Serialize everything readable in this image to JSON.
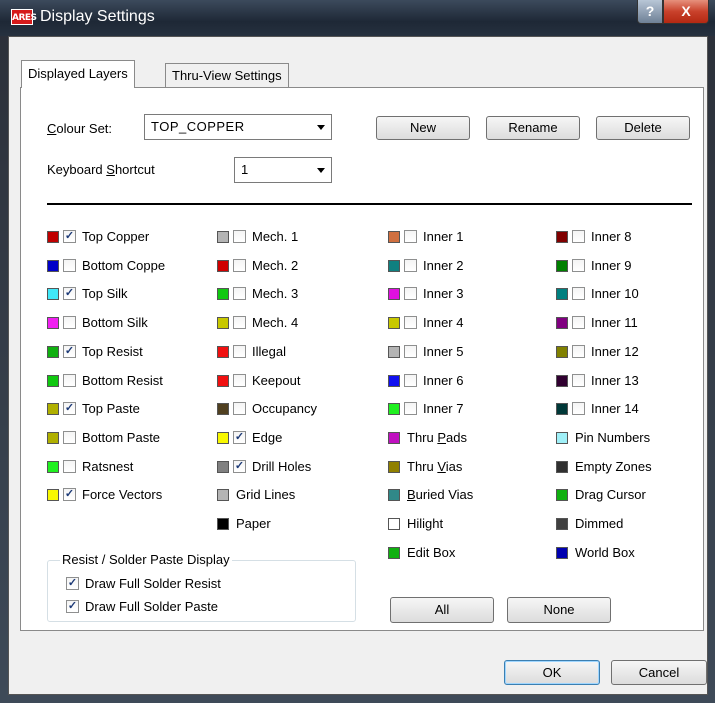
{
  "window": {
    "title": "Display Settings",
    "app_icon_text": "ARES",
    "help_symbol": "?",
    "close_symbol": "X"
  },
  "tabs": [
    {
      "label": "Displayed Layers"
    },
    {
      "label": "Thru-View Settings"
    }
  ],
  "colour_set": {
    "label": "Colour Set:",
    "value": "TOP_COPPER"
  },
  "keyboard_shortcut": {
    "label": "Keyboard Shortcut",
    "value": "1"
  },
  "buttons": {
    "new": "New",
    "rename": "Rename",
    "delete": "Delete",
    "all": "All",
    "none": "None",
    "ok": "OK",
    "cancel": "Cancel"
  },
  "layers": [
    [
      {
        "label": "Top Copper",
        "color": "#c00000",
        "checkbox": true,
        "checked": true
      },
      {
        "label": "Bottom Coppe",
        "color": "#0000c8",
        "checkbox": true,
        "checked": false
      },
      {
        "label": "Top Silk",
        "color": "#40e8f8",
        "checkbox": true,
        "checked": true
      },
      {
        "label": "Bottom Silk",
        "color": "#f020f0",
        "checkbox": true,
        "checked": false
      },
      {
        "label": "Top Resist",
        "color": "#10b010",
        "checkbox": true,
        "checked": true
      },
      {
        "label": "Bottom Resist",
        "color": "#10c810",
        "checkbox": true,
        "checked": false
      },
      {
        "label": "Top Paste",
        "color": "#b0b000",
        "checkbox": true,
        "checked": true
      },
      {
        "label": "Bottom Paste",
        "color": "#b0b000",
        "checkbox": true,
        "checked": false
      },
      {
        "label": "Ratsnest",
        "color": "#20f020",
        "checkbox": true,
        "checked": false
      },
      {
        "label": "Force Vectors",
        "color": "#f8f800",
        "checkbox": true,
        "checked": true
      }
    ],
    [
      {
        "label": "Mech. 1",
        "color": "#b4b4b4",
        "checkbox": true,
        "checked": false
      },
      {
        "label": "Mech. 2",
        "color": "#d00000",
        "checkbox": true,
        "checked": false
      },
      {
        "label": "Mech. 3",
        "color": "#10c810",
        "checkbox": true,
        "checked": false
      },
      {
        "label": "Mech. 4",
        "color": "#c8c800",
        "checkbox": true,
        "checked": false
      },
      {
        "label": "Illegal",
        "color": "#f01010",
        "checkbox": true,
        "checked": false
      },
      {
        "label": "Keepout",
        "color": "#f01010",
        "checkbox": true,
        "checked": false
      },
      {
        "label": "Occupancy",
        "color": "#504020",
        "checkbox": true,
        "checked": false
      },
      {
        "label": "Edge",
        "color": "#f8f800",
        "checkbox": true,
        "checked": true
      },
      {
        "label": "Drill Holes",
        "color": "#808080",
        "checkbox": true,
        "checked": true
      },
      {
        "label": "Grid Lines",
        "color": "#b4b4b4",
        "checkbox": false,
        "checked": false
      },
      {
        "label": "Paper",
        "color": "#000000",
        "checkbox": false,
        "checked": false
      }
    ],
    [
      {
        "label": "Inner 1",
        "color": "#d07040",
        "checkbox": true,
        "checked": false
      },
      {
        "label": "Inner 2",
        "color": "#108080",
        "checkbox": true,
        "checked": false
      },
      {
        "label": "Inner 3",
        "color": "#e010e0",
        "checkbox": true,
        "checked": false
      },
      {
        "label": "Inner 4",
        "color": "#c8c800",
        "checkbox": true,
        "checked": false
      },
      {
        "label": "Inner 5",
        "color": "#b4b4b4",
        "checkbox": true,
        "checked": false
      },
      {
        "label": "Inner 6",
        "color": "#1010f0",
        "checkbox": true,
        "checked": false
      },
      {
        "label": "Inner 7",
        "color": "#20f020",
        "checkbox": true,
        "checked": false
      },
      {
        "label": "Thru Pads",
        "u": "P",
        "color": "#c010c0",
        "checkbox": false,
        "checked": false
      },
      {
        "label": "Thru Vias",
        "u": "V",
        "color": "#908000",
        "checkbox": false,
        "checked": false
      },
      {
        "label": "Buried Vias",
        "u": "B",
        "color": "#308888",
        "checkbox": false,
        "checked": false
      },
      {
        "label": "Hilight",
        "color": "#ffffff",
        "checkbox": false,
        "checked": false
      },
      {
        "label": "Edit Box",
        "color": "#10b010",
        "checkbox": false,
        "checked": false
      }
    ],
    [
      {
        "label": "Inner 8",
        "color": "#800000",
        "checkbox": true,
        "checked": false
      },
      {
        "label": "Inner 9",
        "color": "#008000",
        "checkbox": true,
        "checked": false
      },
      {
        "label": "Inner 10",
        "color": "#008080",
        "checkbox": true,
        "checked": false
      },
      {
        "label": "Inner 11",
        "color": "#800080",
        "checkbox": true,
        "checked": false
      },
      {
        "label": "Inner 12",
        "color": "#808000",
        "checkbox": true,
        "checked": false
      },
      {
        "label": "Inner 13",
        "color": "#300030",
        "checkbox": true,
        "checked": false
      },
      {
        "label": "Inner 14",
        "color": "#003838",
        "checkbox": true,
        "checked": false
      },
      {
        "label": "Pin Numbers",
        "color": "#a0f0f8",
        "checkbox": false,
        "checked": false
      },
      {
        "label": "Empty Zones",
        "color": "#303030",
        "checkbox": false,
        "checked": false
      },
      {
        "label": "Drag Cursor",
        "color": "#10b010",
        "checkbox": false,
        "checked": false
      },
      {
        "label": "Dimmed",
        "color": "#404040",
        "checkbox": false,
        "checked": false
      },
      {
        "label": "World Box",
        "color": "#0000b0",
        "checkbox": false,
        "checked": false
      }
    ]
  ],
  "resist_group": {
    "title": "Resist / Solder Paste Display",
    "options": [
      {
        "label": "Draw Full Solder Resist",
        "checked": true
      },
      {
        "label": "Draw Full Solder Paste",
        "checked": true
      }
    ]
  },
  "check_glyph": "✓"
}
